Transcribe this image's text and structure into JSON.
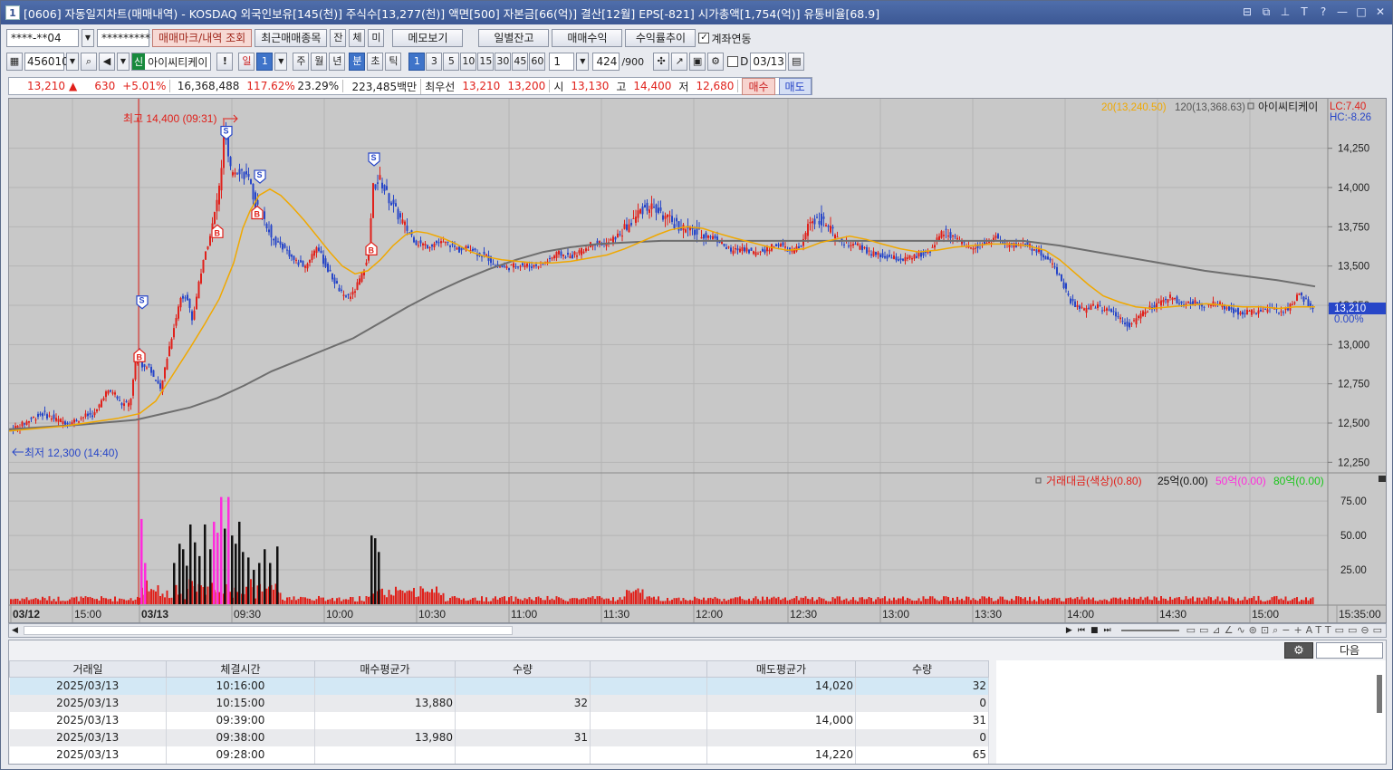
{
  "window": {
    "title": "[0606] 자동일지차트(매매내역) - KOSDAQ 외국인보유[145(천)] 주식수[13,277(천)] 액면[500] 자본금[66(억)] 결산[12월] EPS[-821] 시가총액[1,754(억)] 유통비율[68.9]",
    "app_icon": "1"
  },
  "toolbar1": {
    "account": "****-**04",
    "password": "*********",
    "trade_mark_btn": "매매마크/내역 조회",
    "recent_items_btn": "최근매매종목",
    "tab_jan": "잔",
    "tab_che": "체",
    "tab_mi": "미",
    "memo_btn": "메모보기",
    "daily_balance_btn": "일별잔고",
    "trade_profit_btn": "매매수익",
    "return_trend_btn": "수익률추이",
    "account_link_label": "계좌연동"
  },
  "toolbar2": {
    "code": "456010",
    "badge": "신",
    "name": "아이씨티케이",
    "warn": "!",
    "day_label": "일",
    "day_val": "1",
    "week": "주",
    "month": "월",
    "year": "년",
    "minute": "분",
    "second": "초",
    "tick": "틱",
    "periods": [
      "1",
      "3",
      "5",
      "10",
      "15",
      "30",
      "45",
      "60"
    ],
    "count_val": "1",
    "bars": "424",
    "bars_total": "/900",
    "d_label": "D",
    "date": "03/13"
  },
  "quote": {
    "price": "13,210",
    "change": "630",
    "change_pct": "+5.01%",
    "volume": "16,368,488",
    "vol_ratio": "117.62%",
    "turnover": "23.29%",
    "amount": "223,485백만",
    "best_label": "최우선",
    "ask": "13,210",
    "bid": "13,200",
    "open_label": "시",
    "open": "13,130",
    "high_label": "고",
    "high": "14,400",
    "low_label": "저",
    "low": "12,680",
    "buy_btn": "매수",
    "sell_btn": "매도"
  },
  "colors": {
    "up": "#e0201a",
    "down": "#2746c8",
    "ma20": "#f0a800",
    "ma120": "#6e6e6e",
    "vol_pink": "#ff2cdc",
    "vol_black": "#111111"
  },
  "chart_data": {
    "type": "candlestick",
    "legend_ma20": "20(13,240.50)",
    "legend_ma120": "120(13,368.63)",
    "legend_name": "아이씨티케이",
    "lc": "LC:7.40",
    "hc": "HC:-8.26",
    "high_annotation": "최고 14,400 (09:31)",
    "low_annotation": "최저 12,300 (14:40)",
    "current_price": "13,210",
    "current_pct": "0.00%",
    "y_ticks": [
      "14,250",
      "14,000",
      "13,750",
      "13,500",
      "13,250",
      "13,000",
      "12,750",
      "12,500",
      "12,250"
    ],
    "ylim": [
      12200,
      14450
    ],
    "x_labels": [
      "03/12",
      "15:00",
      "03/13",
      "09:30",
      "10:00",
      "10:30",
      "11:00",
      "11:30",
      "12:00",
      "12:30",
      "13:00",
      "13:30",
      "14:00",
      "14:30",
      "15:00",
      "15:35:00"
    ],
    "volume_legend": {
      "amount": "거래대금(색상)(0.80)",
      "l25": "25억(0.00)",
      "l50": "50억(0.00)",
      "l80": "80억(0.00)"
    },
    "volume_ticks": [
      "75.00",
      "50.00",
      "25.00"
    ],
    "price_path": [
      [
        0,
        12450
      ],
      [
        14,
        12480
      ],
      [
        28,
        12530
      ],
      [
        40,
        12560
      ],
      [
        55,
        12520
      ],
      [
        70,
        12500
      ],
      [
        84,
        12540
      ],
      [
        98,
        12560
      ],
      [
        108,
        12690
      ],
      [
        118,
        12700
      ],
      [
        126,
        12620
      ],
      [
        136,
        12620
      ],
      [
        144,
        12960
      ],
      [
        150,
        12850
      ],
      [
        156,
        12880
      ],
      [
        163,
        12780
      ],
      [
        170,
        12700
      ],
      [
        176,
        12900
      ],
      [
        184,
        13100
      ],
      [
        192,
        13300
      ],
      [
        198,
        13320
      ],
      [
        205,
        13150
      ],
      [
        212,
        13400
      ],
      [
        220,
        13600
      ],
      [
        228,
        13780
      ],
      [
        236,
        14050
      ],
      [
        240,
        14400
      ],
      [
        246,
        14100
      ],
      [
        256,
        14120
      ],
      [
        266,
        14060
      ],
      [
        274,
        13900
      ],
      [
        286,
        13780
      ],
      [
        296,
        13650
      ],
      [
        306,
        13620
      ],
      [
        318,
        13530
      ],
      [
        330,
        13500
      ],
      [
        342,
        13630
      ],
      [
        352,
        13500
      ],
      [
        362,
        13400
      ],
      [
        372,
        13300
      ],
      [
        382,
        13320
      ],
      [
        392,
        13440
      ],
      [
        400,
        13600
      ],
      [
        404,
        14000
      ],
      [
        412,
        14050
      ],
      [
        420,
        13950
      ],
      [
        430,
        13840
      ],
      [
        440,
        13750
      ],
      [
        452,
        13650
      ],
      [
        464,
        13630
      ],
      [
        476,
        13650
      ],
      [
        488,
        13640
      ],
      [
        500,
        13600
      ],
      [
        512,
        13620
      ],
      [
        520,
        13580
      ],
      [
        530,
        13560
      ],
      [
        540,
        13500
      ],
      [
        552,
        13490
      ],
      [
        566,
        13510
      ],
      [
        580,
        13500
      ],
      [
        594,
        13520
      ],
      [
        608,
        13580
      ],
      [
        622,
        13560
      ],
      [
        636,
        13600
      ],
      [
        648,
        13650
      ],
      [
        662,
        13640
      ],
      [
        676,
        13700
      ],
      [
        690,
        13780
      ],
      [
        700,
        13860
      ],
      [
        712,
        13880
      ],
      [
        724,
        13820
      ],
      [
        740,
        13760
      ],
      [
        756,
        13720
      ],
      [
        770,
        13700
      ],
      [
        782,
        13680
      ],
      [
        790,
        13640
      ],
      [
        800,
        13590
      ],
      [
        812,
        13620
      ],
      [
        826,
        13580
      ],
      [
        840,
        13610
      ],
      [
        852,
        13640
      ],
      [
        866,
        13590
      ],
      [
        878,
        13630
      ],
      [
        886,
        13790
      ],
      [
        898,
        13800
      ],
      [
        908,
        13740
      ],
      [
        918,
        13660
      ],
      [
        930,
        13640
      ],
      [
        942,
        13620
      ],
      [
        954,
        13580
      ],
      [
        966,
        13560
      ],
      [
        978,
        13550
      ],
      [
        990,
        13540
      ],
      [
        1004,
        13560
      ],
      [
        1018,
        13590
      ],
      [
        1030,
        13700
      ],
      [
        1040,
        13720
      ],
      [
        1050,
        13660
      ],
      [
        1060,
        13620
      ],
      [
        1072,
        13630
      ],
      [
        1084,
        13650
      ],
      [
        1092,
        13690
      ],
      [
        1100,
        13640
      ],
      [
        1112,
        13630
      ],
      [
        1124,
        13650
      ],
      [
        1136,
        13600
      ],
      [
        1146,
        13560
      ],
      [
        1156,
        13500
      ],
      [
        1164,
        13420
      ],
      [
        1172,
        13300
      ],
      [
        1180,
        13240
      ],
      [
        1190,
        13220
      ],
      [
        1200,
        13250
      ],
      [
        1210,
        13230
      ],
      [
        1220,
        13220
      ],
      [
        1230,
        13160
      ],
      [
        1240,
        13120
      ],
      [
        1250,
        13180
      ],
      [
        1262,
        13230
      ],
      [
        1274,
        13260
      ],
      [
        1286,
        13310
      ],
      [
        1298,
        13250
      ],
      [
        1310,
        13270
      ],
      [
        1324,
        13250
      ],
      [
        1338,
        13260
      ],
      [
        1352,
        13220
      ],
      [
        1366,
        13200
      ],
      [
        1380,
        13210
      ],
      [
        1394,
        13230
      ],
      [
        1406,
        13200
      ],
      [
        1418,
        13250
      ],
      [
        1426,
        13320
      ],
      [
        1434,
        13280
      ],
      [
        1442,
        13210
      ]
    ],
    "ma20_path": [
      [
        0,
        12450
      ],
      [
        60,
        12480
      ],
      [
        120,
        12530
      ],
      [
        144,
        12560
      ],
      [
        162,
        12640
      ],
      [
        180,
        12800
      ],
      [
        200,
        12980
      ],
      [
        216,
        13130
      ],
      [
        232,
        13290
      ],
      [
        248,
        13520
      ],
      [
        258,
        13740
      ],
      [
        266,
        13850
      ],
      [
        276,
        13950
      ],
      [
        288,
        13990
      ],
      [
        300,
        13950
      ],
      [
        312,
        13880
      ],
      [
        326,
        13790
      ],
      [
        340,
        13690
      ],
      [
        354,
        13590
      ],
      [
        368,
        13500
      ],
      [
        382,
        13450
      ],
      [
        396,
        13470
      ],
      [
        410,
        13540
      ],
      [
        424,
        13630
      ],
      [
        438,
        13700
      ],
      [
        450,
        13720
      ],
      [
        462,
        13710
      ],
      [
        478,
        13680
      ],
      [
        494,
        13640
      ],
      [
        510,
        13590
      ],
      [
        526,
        13560
      ],
      [
        544,
        13540
      ],
      [
        562,
        13530
      ],
      [
        580,
        13520
      ],
      [
        600,
        13520
      ],
      [
        620,
        13530
      ],
      [
        640,
        13550
      ],
      [
        660,
        13570
      ],
      [
        680,
        13610
      ],
      [
        700,
        13660
      ],
      [
        716,
        13700
      ],
      [
        730,
        13730
      ],
      [
        748,
        13750
      ],
      [
        766,
        13740
      ],
      [
        782,
        13710
      ],
      [
        800,
        13680
      ],
      [
        820,
        13650
      ],
      [
        840,
        13620
      ],
      [
        860,
        13600
      ],
      [
        878,
        13610
      ],
      [
        896,
        13650
      ],
      [
        912,
        13670
      ],
      [
        928,
        13690
      ],
      [
        946,
        13670
      ],
      [
        964,
        13640
      ],
      [
        984,
        13610
      ],
      [
        1004,
        13590
      ],
      [
        1024,
        13600
      ],
      [
        1044,
        13620
      ],
      [
        1064,
        13630
      ],
      [
        1084,
        13640
      ],
      [
        1104,
        13640
      ],
      [
        1124,
        13630
      ],
      [
        1144,
        13600
      ],
      [
        1160,
        13540
      ],
      [
        1176,
        13460
      ],
      [
        1192,
        13380
      ],
      [
        1208,
        13310
      ],
      [
        1226,
        13270
      ],
      [
        1244,
        13240
      ],
      [
        1262,
        13230
      ],
      [
        1282,
        13240
      ],
      [
        1302,
        13250
      ],
      [
        1322,
        13260
      ],
      [
        1342,
        13250
      ],
      [
        1362,
        13240
      ],
      [
        1382,
        13240
      ],
      [
        1402,
        13230
      ],
      [
        1420,
        13240
      ],
      [
        1442,
        13240
      ]
    ],
    "ma120_path": [
      [
        0,
        12460
      ],
      [
        80,
        12490
      ],
      [
        140,
        12520
      ],
      [
        170,
        12560
      ],
      [
        200,
        12600
      ],
      [
        230,
        12660
      ],
      [
        260,
        12740
      ],
      [
        290,
        12830
      ],
      [
        320,
        12900
      ],
      [
        350,
        12970
      ],
      [
        380,
        13040
      ],
      [
        410,
        13140
      ],
      [
        440,
        13240
      ],
      [
        470,
        13330
      ],
      [
        500,
        13410
      ],
      [
        530,
        13480
      ],
      [
        560,
        13540
      ],
      [
        590,
        13590
      ],
      [
        620,
        13620
      ],
      [
        650,
        13640
      ],
      [
        680,
        13650
      ],
      [
        720,
        13660
      ],
      [
        760,
        13660
      ],
      [
        800,
        13660
      ],
      [
        840,
        13660
      ],
      [
        880,
        13660
      ],
      [
        920,
        13660
      ],
      [
        960,
        13660
      ],
      [
        1000,
        13660
      ],
      [
        1040,
        13660
      ],
      [
        1080,
        13660
      ],
      [
        1120,
        13660
      ],
      [
        1160,
        13630
      ],
      [
        1200,
        13590
      ],
      [
        1240,
        13550
      ],
      [
        1280,
        13510
      ],
      [
        1320,
        13470
      ],
      [
        1360,
        13440
      ],
      [
        1400,
        13410
      ],
      [
        1442,
        13370
      ]
    ],
    "buy_markers": [
      [
        144,
        12960
      ],
      [
        230,
        13750
      ],
      [
        274,
        13870
      ],
      [
        400,
        13640
      ]
    ],
    "sell_markers": [
      [
        147,
        13240
      ],
      [
        240,
        14320
      ],
      [
        277,
        14040
      ],
      [
        403,
        14150
      ]
    ],
    "volume_spikes": [
      [
        146,
        62,
        "pink"
      ],
      [
        150,
        30,
        "pink"
      ],
      [
        182,
        30,
        "black"
      ],
      [
        188,
        44,
        "black"
      ],
      [
        192,
        40,
        "black"
      ],
      [
        196,
        28,
        "black"
      ],
      [
        200,
        58,
        "black"
      ],
      [
        205,
        45,
        "black"
      ],
      [
        210,
        35,
        "black"
      ],
      [
        216,
        58,
        "black"
      ],
      [
        222,
        40,
        "black"
      ],
      [
        226,
        60,
        "pink"
      ],
      [
        230,
        52,
        "pink"
      ],
      [
        234,
        78,
        "pink"
      ],
      [
        238,
        55,
        "black"
      ],
      [
        242,
        78,
        "pink"
      ],
      [
        246,
        50,
        "black"
      ],
      [
        250,
        44,
        "black"
      ],
      [
        254,
        60,
        "black"
      ],
      [
        258,
        38,
        "black"
      ],
      [
        264,
        34,
        "black"
      ],
      [
        270,
        25,
        "black"
      ],
      [
        276,
        30,
        "black"
      ],
      [
        282,
        40,
        "black"
      ],
      [
        288,
        30,
        "black"
      ],
      [
        296,
        42,
        "black"
      ],
      [
        400,
        50,
        "black"
      ],
      [
        404,
        48,
        "black"
      ],
      [
        408,
        38,
        "black"
      ]
    ]
  },
  "scrollbar": {
    "next_btn": "다음"
  },
  "table": {
    "headers": [
      "거래일",
      "체결시간",
      "매수평균가",
      "수량",
      "",
      "매도평균가",
      "수량"
    ],
    "rows": [
      [
        "2025/03/13",
        "10:16:00",
        "",
        "",
        "",
        "14,020",
        "32"
      ],
      [
        "2025/03/13",
        "10:15:00",
        "13,880",
        "32",
        "",
        "",
        "0"
      ],
      [
        "2025/03/13",
        "09:39:00",
        "",
        "",
        "",
        "14,000",
        "31"
      ],
      [
        "2025/03/13",
        "09:38:00",
        "13,980",
        "31",
        "",
        "",
        "0"
      ],
      [
        "2025/03/13",
        "09:28:00",
        "",
        "",
        "",
        "14,220",
        "65"
      ]
    ]
  }
}
